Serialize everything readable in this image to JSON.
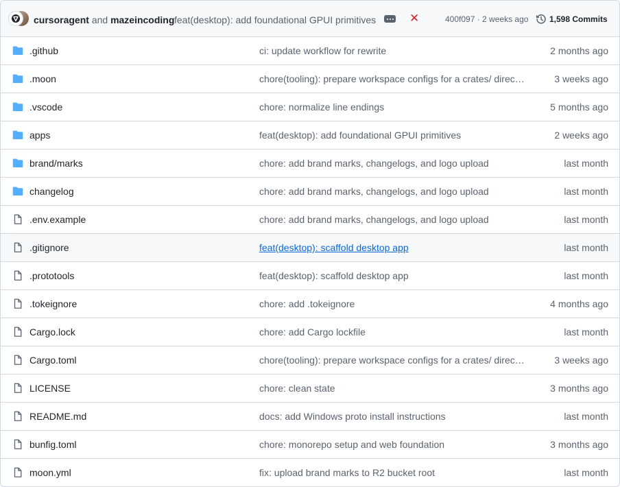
{
  "header": {
    "author1": "cursoragent",
    "and_text": "and",
    "author2": "mazeincoding",
    "commit_message": "feat(desktop): add foundational GPUI primitives",
    "status": "failure",
    "sha_time": "400f097 · 2 weeks ago",
    "commits_label": "1,598 Commits",
    "icons": [
      "avatar-cursoragent",
      "avatar-mazeincoding",
      "ellipsis-icon",
      "x-icon",
      "history-icon"
    ]
  },
  "files": [
    {
      "type": "dir",
      "name": ".github",
      "message": "ci: update workflow for rewrite",
      "age": "2 months ago"
    },
    {
      "type": "dir",
      "name": ".moon",
      "message": "chore(tooling): prepare workspace configs for a crates/ direct…",
      "age": "3 weeks ago"
    },
    {
      "type": "dir",
      "name": ".vscode",
      "message": "chore: normalize line endings",
      "age": "5 months ago"
    },
    {
      "type": "dir",
      "name": "apps",
      "message": "feat(desktop): add foundational GPUI primitives",
      "age": "2 weeks ago"
    },
    {
      "type": "dir",
      "name": "brand/marks",
      "message": "chore: add brand marks, changelogs, and logo upload",
      "age": "last month"
    },
    {
      "type": "dir",
      "name": "changelog",
      "message": "chore: add brand marks, changelogs, and logo upload",
      "age": "last month"
    },
    {
      "type": "file",
      "name": ".env.example",
      "message": "chore: add brand marks, changelogs, and logo upload",
      "age": "last month"
    },
    {
      "type": "file",
      "name": ".gitignore",
      "message": "feat(desktop): scaffold desktop app",
      "age": "last month"
    },
    {
      "type": "file",
      "name": ".prototools",
      "message": "feat(desktop): scaffold desktop app",
      "age": "last month"
    },
    {
      "type": "file",
      "name": ".tokeignore",
      "message": "chore: add .tokeignore",
      "age": "4 months ago"
    },
    {
      "type": "file",
      "name": "Cargo.lock",
      "message": "chore: add Cargo lockfile",
      "age": "last month"
    },
    {
      "type": "file",
      "name": "Cargo.toml",
      "message": "chore(tooling): prepare workspace configs for a crates/ direct…",
      "age": "3 weeks ago"
    },
    {
      "type": "file",
      "name": "LICENSE",
      "message": "chore: clean state",
      "age": "3 months ago"
    },
    {
      "type": "file",
      "name": "README.md",
      "message": "docs: add Windows proto install instructions",
      "age": "last month"
    },
    {
      "type": "file",
      "name": "bunfig.toml",
      "message": "chore: monorepo setup and web foundation",
      "age": "3 months ago"
    },
    {
      "type": "file",
      "name": "moon.yml",
      "message": "fix: upload brand marks to R2 bucket root",
      "age": "last month"
    }
  ],
  "hovered_row_name": ".gitignore",
  "colors": {
    "folder": "#54aeff",
    "file_icon": "#59636e",
    "link": "#0969da",
    "failure": "#d1242f",
    "muted": "#59636e",
    "border": "#d1d9e0",
    "header_bg": "#f6f8fa"
  }
}
